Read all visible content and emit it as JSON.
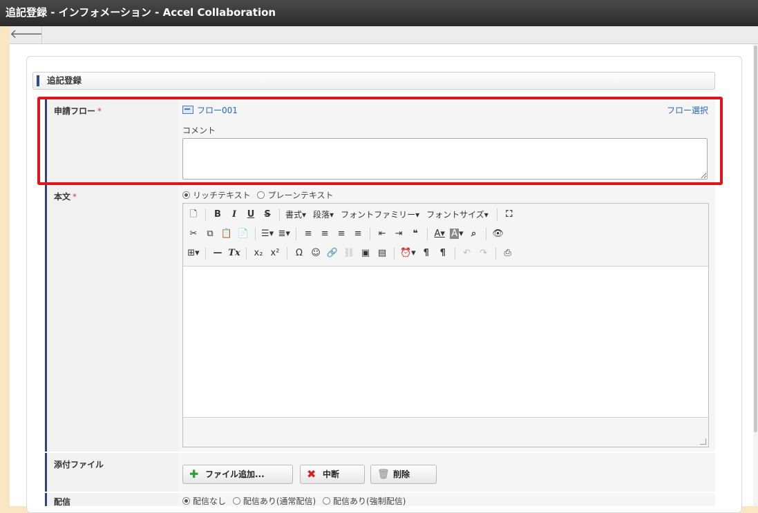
{
  "window": {
    "title": "追記登録 - インフォメーション - Accel Collaboration"
  },
  "nav": {
    "back_icon": "arrow-left-icon",
    "back_glyph": "🡐"
  },
  "section": {
    "title": "追記登録"
  },
  "flow": {
    "label": "申請フロー",
    "required": "*",
    "flow_name": "フロー001",
    "select_link": "フロー選択",
    "comment_label": "コメント",
    "comment_value": ""
  },
  "body": {
    "label": "本文",
    "required": "*",
    "format_options": [
      {
        "label": "リッチテキスト",
        "checked": true
      },
      {
        "label": "プレーンテキスト",
        "checked": false
      }
    ],
    "toolbar": {
      "row1": [
        "書式▾",
        "段落▾",
        "フォントファミリー▾",
        "フォントサイズ▾"
      ]
    }
  },
  "attachments": {
    "label": "添付ファイル",
    "add_button": "ファイル追加...",
    "cancel_button": "中断",
    "delete_button": "削除"
  },
  "delivery": {
    "label": "配信",
    "options": [
      {
        "label": "配信なし",
        "checked": true
      },
      {
        "label": "配信あり(通常配信)",
        "checked": false
      },
      {
        "label": "配信あり(強制配信)",
        "checked": false
      }
    ]
  },
  "colors": {
    "accent_red": "#e0141c",
    "link_blue": "#2465c3",
    "label_bar": "#32407e",
    "title_bg": "#333333"
  }
}
